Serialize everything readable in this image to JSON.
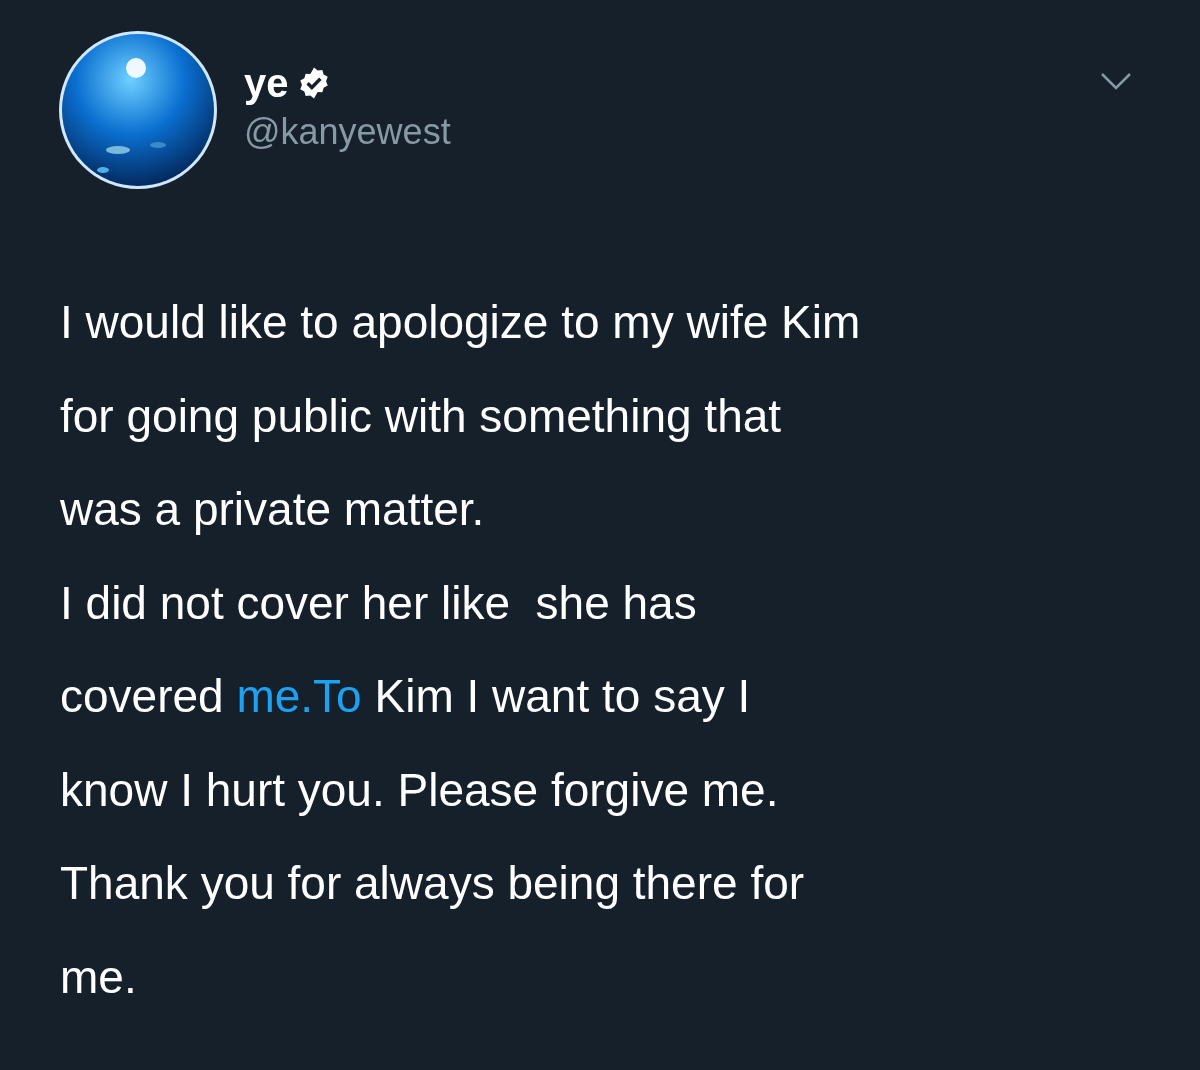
{
  "tweet": {
    "author": {
      "name": "ye",
      "verified": true,
      "handle": "@kanyewest"
    },
    "body": [
      {
        "kind": "text",
        "text": "I would like to apologize to my wife Kim\nfor going public with something that\nwas a private matter.\nI did not cover her like  she has\ncovered "
      },
      {
        "kind": "link",
        "text": "me.To"
      },
      {
        "kind": "text",
        "text": " Kim I want to say I\nknow I hurt you. Please forgive me.\nThank you for always being there for\nme."
      }
    ]
  }
}
